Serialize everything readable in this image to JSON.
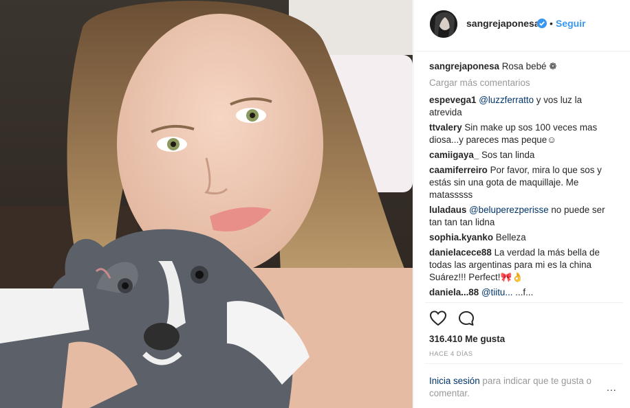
{
  "post": {
    "username": "sangrejaponesa",
    "separator": "•",
    "follow_label": "Seguir",
    "caption_user": "sangrejaponesa",
    "caption_text": "Rosa bebé ❁",
    "load_more": "Cargar más comentarios"
  },
  "comments": [
    {
      "user": "espevega1",
      "mention": "@luzzferratto",
      "text": " y vos luz la atrevida"
    },
    {
      "user": "ttvalery",
      "mention": "",
      "text": "Sin make up sos 100 veces mas diosa...y pareces mas peque☺"
    },
    {
      "user": "camiigaya_",
      "mention": "",
      "text": "Sos tan linda"
    },
    {
      "user": "caamiferreiro",
      "mention": "",
      "text": "Por favor, mira lo que sos y estás sin una gota de maquillaje. Me matasssss"
    },
    {
      "user": "luladaus",
      "mention": "@beluperezperisse",
      "text": " no puede ser tan tan tan lidna"
    },
    {
      "user": "sophia.kyanko",
      "mention": "",
      "text": "Belleza"
    },
    {
      "user": "danielacece88",
      "mention": "",
      "text": "La verdad la más bella de todas las argentinas para mi es la china Suárez!!! Perfect!🎀👌"
    },
    {
      "user": "daniela...88",
      "mention": "@tiitu...",
      "text": " ...f..."
    }
  ],
  "stats": {
    "likes": "316.410 Me gusta",
    "time_ago": "HACE 4 DÍAS"
  },
  "login": {
    "link": "Inicia sesión",
    "text": " para indicar que te gusta o comentar."
  },
  "more_label": "...",
  "icons": {
    "verified": "verified-badge-icon",
    "like": "heart-icon",
    "comment": "comment-bubble-icon",
    "more": "more-options-icon"
  },
  "colors": {
    "link_blue": "#3897f0",
    "mention_blue": "#003569",
    "muted": "#999999"
  }
}
